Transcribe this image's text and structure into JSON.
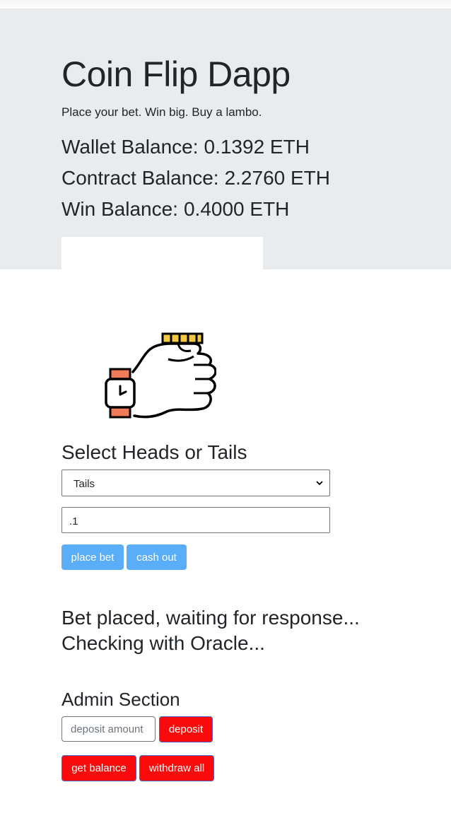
{
  "header": {
    "title": "Coin Flip Dapp",
    "tagline": "Place your bet. Win big. Buy a lambo.",
    "balances": [
      {
        "label": "Wallet Balance:",
        "value": "0.1392 ETH"
      },
      {
        "label": "Contract Balance:",
        "value": "2.2760 ETH"
      },
      {
        "label": "Win Balance:",
        "value": "0.4000 ETH"
      }
    ]
  },
  "bet": {
    "heading": "Select Heads or Tails",
    "choice_selected": "Tails",
    "amount_value": ".1",
    "place_bet_label": "place bet",
    "cash_out_label": "cash out",
    "status_line1": "Bet placed, waiting for response...",
    "status_line2": "Checking with Oracle..."
  },
  "admin": {
    "heading": "Admin Section",
    "deposit_placeholder": "deposit amount",
    "deposit_label": "deposit",
    "get_balance_label": "get balance",
    "withdraw_all_label": "withdraw all"
  },
  "colors": {
    "jumbotron_bg": "#e9ecef",
    "primary_button": "#5aadf8",
    "danger_button": "#fa0a0a",
    "coin": "#f6c945",
    "watch_strap": "#f07a5a"
  },
  "icons": {
    "illustration": "hand-flipping-coin-icon",
    "select_arrow": "chevron-down-icon"
  }
}
